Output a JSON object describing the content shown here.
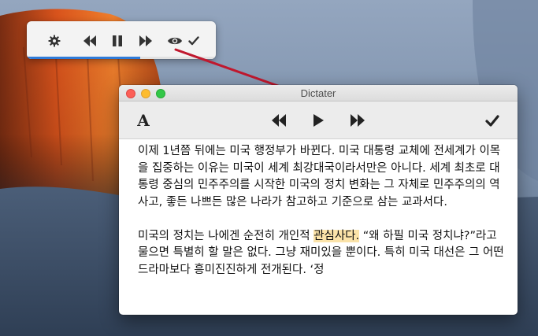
{
  "mini_player": {
    "icons": {
      "settings": "gear-icon",
      "rewind": "rewind-icon",
      "pause": "pause-icon",
      "fast_forward": "fast-forward-icon",
      "eye": "eye-icon",
      "check": "checkmark-icon"
    },
    "progress": 0.6,
    "progress_color": "#2f7bd8"
  },
  "window": {
    "title": "Dictater",
    "toolbar": {
      "font_label": "A",
      "icons": {
        "rewind": "rewind-icon",
        "play": "play-icon",
        "fast_forward": "fast-forward-icon",
        "check": "checkmark-icon"
      }
    },
    "paragraphs": [
      {
        "text": "이제 1년쯤 뒤에는 미국 행정부가 바뀐다. 미국 대통령 교체에 전세계가 이목을 집중하는 이유는 미국이 세계 최강대국이라서만은 아니다. 세계 최초로 대통령 중심의 민주주의를 시작한 미국의 정치 변화는 그 자체로 민주주의의 역사고, 좋든 나쁘든 많은 나라가 참고하고 기준으로 삼는 교과서다."
      },
      {
        "before": "미국의 정치는 나에겐 순전히 개인적 ",
        "highlight": "관심사다.",
        "after": " “왜 하필 미국 정치냐?”라고 물으면 특별히 할 말은 없다. 그냥 재미있을 뿐이다. 특히 미국 대선은 그 어떤 드라마보다 흥미진진하게 전개된다. ‘정"
      }
    ],
    "highlight_color": "#fbe3a9"
  },
  "annotation": {
    "color": "#c0182e"
  }
}
